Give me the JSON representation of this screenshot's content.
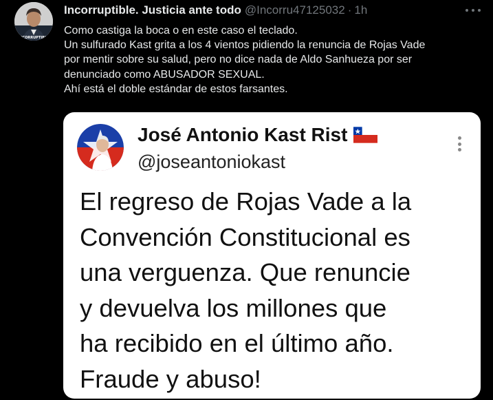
{
  "tweet": {
    "author_name": "Incorruptible. Justicia ante todo",
    "author_handle": "@Incorru47125032",
    "separator": "·",
    "time": "1h",
    "avatar_caption": "INCORRUPTIBLE",
    "icons": {
      "avatar": "profile-photo",
      "more": "more-horizontal-icon"
    },
    "body_lines": [
      "Como castiga la boca o en este caso el teclado.",
      "Un sulfurado Kast grita a los 4 vientos pidiendo la renuncia de Rojas Vade",
      "por mentir sobre su salud, pero no dice nada de Aldo Sanhueza por ser",
      "denunciado como ABUSADOR SEXUAL.",
      "Ahí está el doble estándar de estos farsantes."
    ]
  },
  "quoted": {
    "author_name": "José Antonio Kast Rist",
    "author_handle": "@joseantoniokast",
    "flag": "chile-flag",
    "icons": {
      "more": "more-vertical-icon"
    },
    "text_lines": [
      "El regreso de Rojas Vade a la",
      "Convención Constitucional es",
      "una verguenza. Que renuncie",
      "y devuelva los millones que",
      "ha recibido en el último año.",
      "Fraude y abuso!"
    ]
  },
  "colors": {
    "background": "#000000",
    "primary_text": "#e7e9ea",
    "secondary_text": "#71767b",
    "card_background": "#ffffff",
    "flag_red": "#d52b1e",
    "flag_blue": "#0039a6"
  }
}
